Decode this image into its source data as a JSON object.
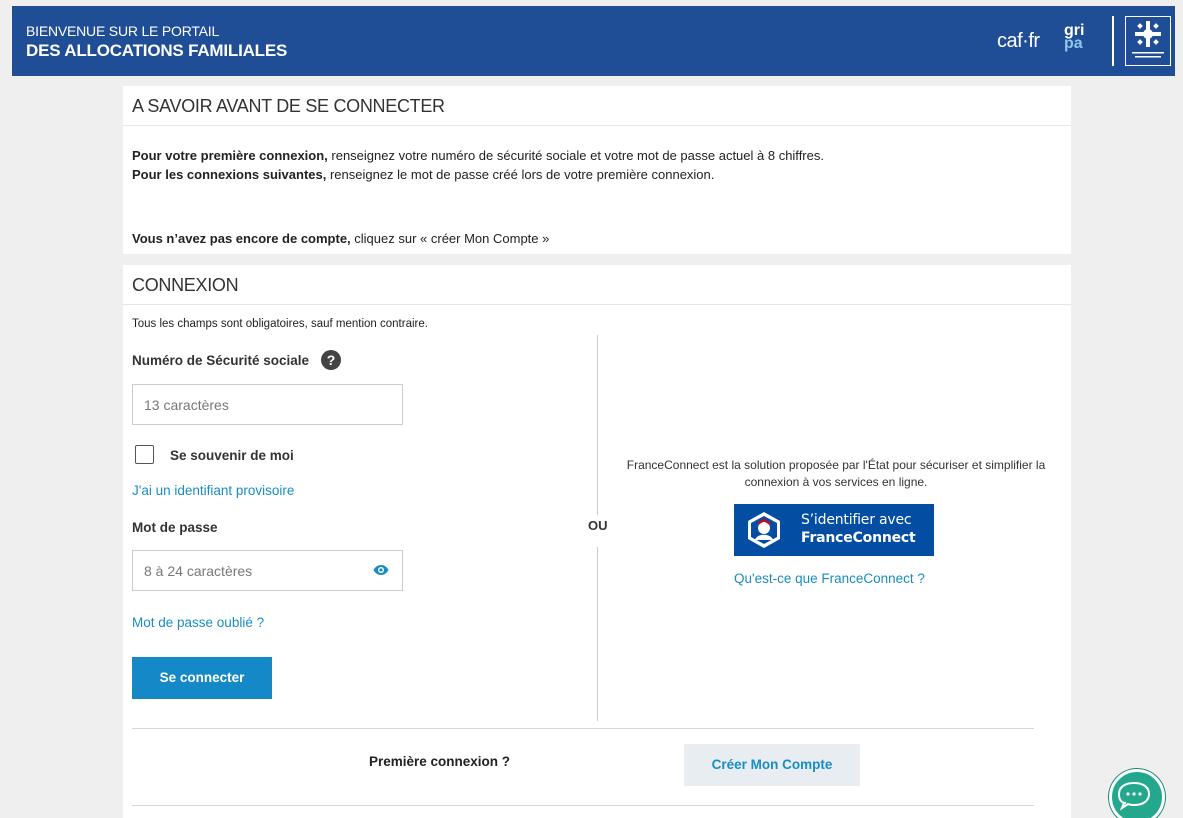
{
  "header": {
    "welcome": "BIENVENUE SUR LE PORTAIL",
    "portal_name": "DES ALLOCATIONS FAMILIALES",
    "caf_logo_text": "caf·fr",
    "gripa_top": "gri",
    "gripa_bottom": "pa",
    "brand_color": "#1f4e96"
  },
  "info_card": {
    "title": "A SAVOIR AVANT DE SE CONNECTER",
    "first_bold": "Pour votre première connexion,",
    "first_text": " renseignez votre numéro de sécurité sociale et votre mot de passe actuel à 8 chiffres.",
    "next_bold": "Pour les connexions suivantes,",
    "next_text": " renseignez le mot de passe créé lors de votre première connexion.",
    "no_account_bold": "Vous n’avez pas encore de compte,",
    "no_account_text": " cliquez sur « créer Mon Compte »"
  },
  "login": {
    "title": "CONNEXION",
    "mandatory_note": "Tous les champs sont obligatoires, sauf mention contraire.",
    "ssn_label": "Numéro de Sécurité sociale",
    "ssn_placeholder": "13 caractères",
    "remember_label": "Se souvenir de moi",
    "temp_id_link": "J'ai un identifiant provisoire",
    "password_label": "Mot de passe",
    "password_placeholder": "8 à 24 caractères",
    "forgot_link": "Mot de passe oublié ?",
    "submit_label": "Se connecter",
    "or_label": "OU",
    "first_connection_label": "Première connexion ?",
    "create_account_label": "Créer Mon Compte",
    "accent_color": "#1589c7"
  },
  "franceconnect": {
    "description": "FranceConnect est la solution proposée par l'État pour sécuriser et simplifier la connexion à vos services en ligne.",
    "button_line1": "S’identifier avec",
    "button_line2": "FranceConnect",
    "info_link": "Qu'est-ce que FranceConnect ?",
    "button_color": "#034ea2"
  },
  "icons": {
    "help": "help-icon",
    "eye": "eye-icon",
    "chat": "chat-icon",
    "caf_emblem": "caf-emblem-icon"
  }
}
